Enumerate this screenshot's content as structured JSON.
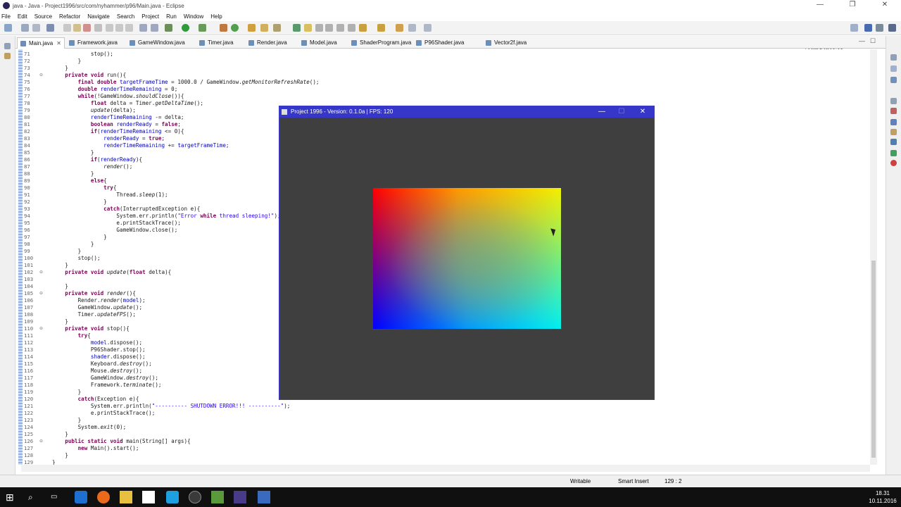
{
  "window": {
    "title": "java - Java - Project1996/src/com/nyhammer/p96/Main.java - Eclipse",
    "minimize": "—",
    "maximize": "❐",
    "close": "✕"
  },
  "menu": [
    "File",
    "Edit",
    "Source",
    "Refactor",
    "Navigate",
    "Search",
    "Project",
    "Run",
    "Window",
    "Help"
  ],
  "quick_access": "Quick Access",
  "tabs": [
    {
      "label": "Main.java",
      "close": "✕"
    },
    {
      "label": "Framework.java"
    },
    {
      "label": "GameWindow.java"
    },
    {
      "label": "Timer.java"
    },
    {
      "label": "Render.java"
    },
    {
      "label": "Model.java"
    },
    {
      "label": "ShaderProgram.java"
    },
    {
      "label": "P96Shader.java"
    },
    {
      "label": "Vector2f.java"
    }
  ],
  "code_lines": [
    {
      "n": "71",
      "t": "            stop();"
    },
    {
      "n": "72",
      "t": "        }"
    },
    {
      "n": "73",
      "t": "    }"
    },
    {
      "n": "74",
      "t": "    private void run(){",
      "fold": true
    },
    {
      "n": "75",
      "t": "        final double targetFrameTime = 1000.0 / GameWindow.getMonitorRefreshRate();"
    },
    {
      "n": "76",
      "t": "        double renderTimeRemaining = 0;"
    },
    {
      "n": "77",
      "t": "        while(!GameWindow.shouldClose()){"
    },
    {
      "n": "78",
      "t": "            float delta = Timer.getDeltaTime();"
    },
    {
      "n": "79",
      "t": "            update(delta);"
    },
    {
      "n": "80",
      "t": "            renderTimeRemaining -= delta;"
    },
    {
      "n": "81",
      "t": "            boolean renderReady = false;"
    },
    {
      "n": "82",
      "t": "            if(renderTimeRemaining <= 0){"
    },
    {
      "n": "83",
      "t": "                renderReady = true;"
    },
    {
      "n": "84",
      "t": "                renderTimeRemaining += targetFrameTime;"
    },
    {
      "n": "85",
      "t": "            }"
    },
    {
      "n": "86",
      "t": "            if(renderReady){"
    },
    {
      "n": "87",
      "t": "                render();"
    },
    {
      "n": "88",
      "t": "            }"
    },
    {
      "n": "89",
      "t": "            else{"
    },
    {
      "n": "90",
      "t": "                try{"
    },
    {
      "n": "91",
      "t": "                    Thread.sleep(1);"
    },
    {
      "n": "92",
      "t": "                }"
    },
    {
      "n": "93",
      "t": "                catch(InterruptedException e){"
    },
    {
      "n": "94",
      "t": "                    System.err.println(\"Error while thread sleeping!\");"
    },
    {
      "n": "95",
      "t": "                    e.printStackTrace();"
    },
    {
      "n": "96",
      "t": "                    GameWindow.close();"
    },
    {
      "n": "97",
      "t": "                }"
    },
    {
      "n": "98",
      "t": "            }"
    },
    {
      "n": "99",
      "t": "        }"
    },
    {
      "n": "100",
      "t": "        stop();"
    },
    {
      "n": "101",
      "t": "    }"
    },
    {
      "n": "102",
      "t": "    private void update(float delta){",
      "fold": true
    },
    {
      "n": "103",
      "t": ""
    },
    {
      "n": "104",
      "t": "    }"
    },
    {
      "n": "105",
      "t": "    private void render(){",
      "fold": true
    },
    {
      "n": "106",
      "t": "        Render.render(model);"
    },
    {
      "n": "107",
      "t": "        GameWindow.update();"
    },
    {
      "n": "108",
      "t": "        Timer.updateFPS();"
    },
    {
      "n": "109",
      "t": "    }"
    },
    {
      "n": "110",
      "t": "    private void stop(){",
      "fold": true
    },
    {
      "n": "111",
      "t": "        try{"
    },
    {
      "n": "112",
      "t": "            model.dispose();"
    },
    {
      "n": "113",
      "t": "            P96Shader.stop();"
    },
    {
      "n": "114",
      "t": "            shader.dispose();"
    },
    {
      "n": "115",
      "t": "            Keyboard.destroy();"
    },
    {
      "n": "116",
      "t": "            Mouse.destroy();"
    },
    {
      "n": "117",
      "t": "            GameWindow.destroy();"
    },
    {
      "n": "118",
      "t": "            Framework.terminate();"
    },
    {
      "n": "119",
      "t": "        }"
    },
    {
      "n": "120",
      "t": "        catch(Exception e){"
    },
    {
      "n": "121",
      "t": "            System.err.println(\"---------- SHUTDOWN ERROR!!! ----------\");"
    },
    {
      "n": "122",
      "t": "            e.printStackTrace();"
    },
    {
      "n": "123",
      "t": "        }"
    },
    {
      "n": "124",
      "t": "        System.exit(0);"
    },
    {
      "n": "125",
      "t": "    }"
    },
    {
      "n": "126",
      "t": "    public static void main(String[] args){",
      "fold": true
    },
    {
      "n": "127",
      "t": "        new Main().start();"
    },
    {
      "n": "128",
      "t": "    }"
    },
    {
      "n": "129",
      "t": "}"
    }
  ],
  "status": {
    "mode": "Writable",
    "insert": "Smart Insert",
    "position": "129 : 2"
  },
  "game_window": {
    "title": "Project 1996 - Version: 0.1.0a | FPS: 120",
    "minimize": "—",
    "maximize": "☐",
    "close": "✕"
  },
  "taskbar": {
    "time": "18.31",
    "date": "10.11.2016"
  },
  "colors": {
    "game_titlebar": "#3636c8",
    "game_bg": "#3f3f3f",
    "quad_top_left": "#ff0000",
    "quad_top_right": "#f4f000",
    "quad_bottom_left": "#0000ff",
    "quad_bottom_right": "#00f0f0"
  }
}
